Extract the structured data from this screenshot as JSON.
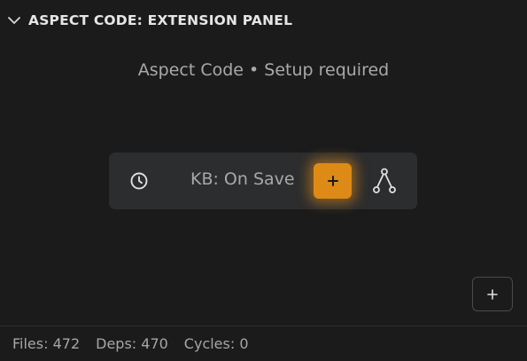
{
  "header": {
    "title": "ASPECT CODE: EXTENSION PANEL",
    "chevron_icon": "chevron-down-icon"
  },
  "subtitle": "Aspect Code • Setup required",
  "toolbar": {
    "clock_icon": "clock-icon",
    "label": "KB: On Save",
    "add_icon": "plus-icon",
    "graph_icon": "graph-icon",
    "accent_color": "#dd8a16"
  },
  "corner_button": {
    "icon": "plus-icon"
  },
  "status": {
    "files": "Files: 472",
    "deps": "Deps: 470",
    "cycles": "Cycles: 0"
  }
}
